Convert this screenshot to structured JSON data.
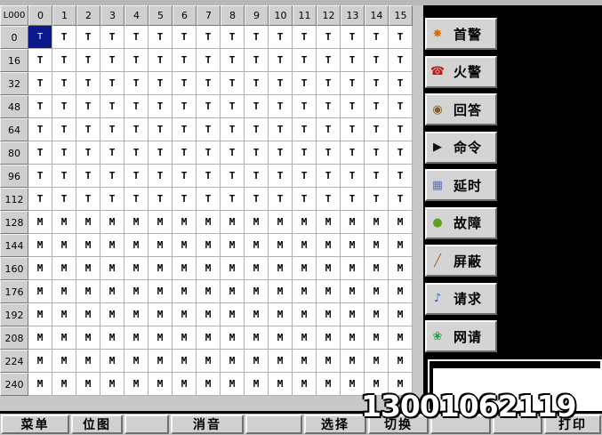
{
  "grid": {
    "corner_label": "L000",
    "col_headers": [
      "0",
      "1",
      "2",
      "3",
      "4",
      "5",
      "6",
      "7",
      "8",
      "9",
      "10",
      "11",
      "12",
      "13",
      "14",
      "15"
    ],
    "row_headers": [
      "0",
      "16",
      "32",
      "48",
      "64",
      "80",
      "96",
      "112",
      "128",
      "144",
      "160",
      "176",
      "192",
      "208",
      "224",
      "240"
    ],
    "t_row_count": 8,
    "t_glyph": "T",
    "m_glyph": "M",
    "selected_cell": "T"
  },
  "sidebar": {
    "buttons": [
      {
        "label": "首警",
        "icon": "alarm-icon",
        "color": "#e07000"
      },
      {
        "label": "火警",
        "icon": "phone-icon",
        "color": "#d01010"
      },
      {
        "label": "回答",
        "icon": "reply-icon",
        "color": "#8a5a20"
      },
      {
        "label": "命令",
        "icon": "command-icon",
        "color": "#101010"
      },
      {
        "label": "延时",
        "icon": "clock-icon",
        "color": "#6070c0"
      },
      {
        "label": "故障",
        "icon": "fault-icon",
        "color": "#60a020"
      },
      {
        "label": "屏蔽",
        "icon": "shield-icon",
        "color": "#b05a10"
      },
      {
        "label": "请求",
        "icon": "request-icon",
        "color": "#3060d0"
      },
      {
        "label": "网请",
        "icon": "network-icon",
        "color": "#20a040"
      }
    ]
  },
  "bottombar": {
    "menu": "菜单",
    "bitmap": "位图",
    "mute": "消音",
    "select": "选择",
    "switch": "切换",
    "print": "打印"
  },
  "watermark": "13001062119"
}
